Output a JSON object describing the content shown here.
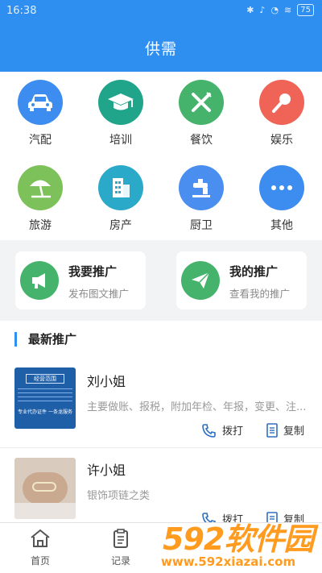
{
  "status_bar": {
    "time": "16:38",
    "battery": "75"
  },
  "header": {
    "title": "供需"
  },
  "categories": [
    {
      "label": "汽配",
      "icon": "car-icon",
      "color": "#3d8cf0"
    },
    {
      "label": "培训",
      "icon": "graduation-cap-icon",
      "color": "#20a58a"
    },
    {
      "label": "餐饮",
      "icon": "fork-knife-icon",
      "color": "#45b36b"
    },
    {
      "label": "娱乐",
      "icon": "microphone-icon",
      "color": "#f06457"
    },
    {
      "label": "旅游",
      "icon": "beach-umbrella-icon",
      "color": "#7dc15a"
    },
    {
      "label": "房产",
      "icon": "building-icon",
      "color": "#2aa9c9"
    },
    {
      "label": "厨卫",
      "icon": "faucet-icon",
      "color": "#4a8ff0"
    },
    {
      "label": "其他",
      "icon": "more-dots-icon",
      "color": "#3d8cf0"
    }
  ],
  "promo_cards": [
    {
      "title": "我要推广",
      "subtitle": "发布图文推广",
      "icon": "megaphone-icon"
    },
    {
      "title": "我的推广",
      "subtitle": "查看我的推广",
      "icon": "paper-plane-icon"
    }
  ],
  "latest": {
    "heading": "最新推广",
    "items": [
      {
        "name": "刘小姐",
        "desc": "主要做账、报税，附加年检、年报，变更、注...",
        "thumb_title": "经营范围",
        "thumb_footer": "专业代办证件 一条龙服务",
        "call_label": "拨打",
        "copy_label": "复制"
      },
      {
        "name": "许小姐",
        "desc": "银饰项链之类",
        "call_label": "拨打",
        "copy_label": "复制"
      }
    ]
  },
  "tabs": [
    {
      "label": "首页",
      "icon": "home-icon"
    },
    {
      "label": "记录",
      "icon": "clipboard-icon"
    }
  ],
  "watermark": {
    "brand": "592软件园",
    "url": "www.592xiazai.com"
  }
}
